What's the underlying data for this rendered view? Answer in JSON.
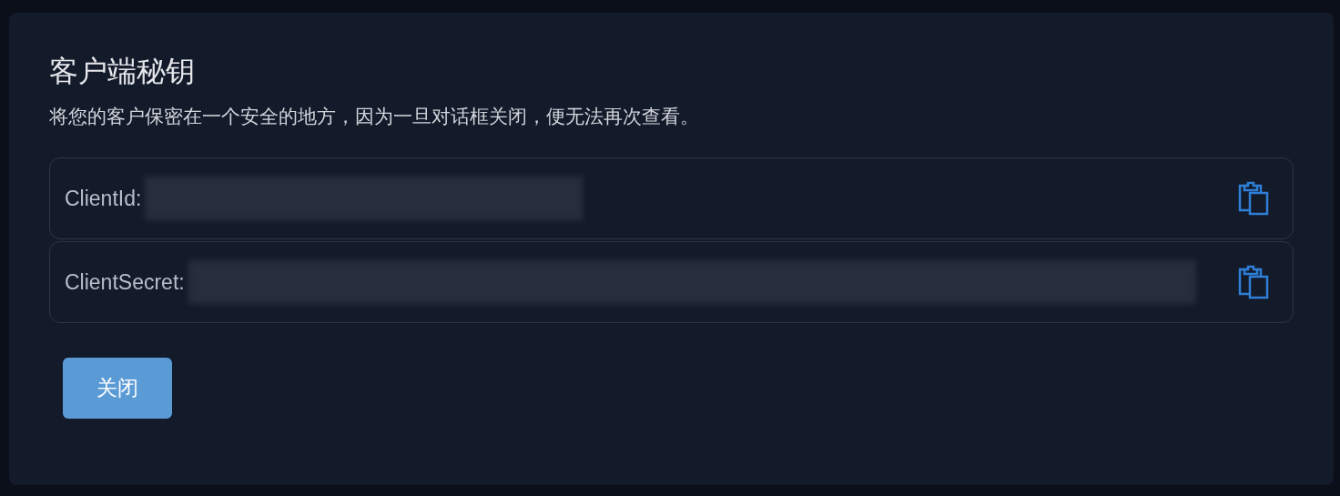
{
  "dialog": {
    "title": "客户端秘钥",
    "description": "将您的客户保密在一个安全的地方，因为一旦对话框关闭，便无法再次查看。",
    "fields": [
      {
        "label": "ClientId:"
      },
      {
        "label": "ClientSecret:"
      }
    ],
    "buttons": [
      {
        "label": "关闭"
      }
    ]
  }
}
